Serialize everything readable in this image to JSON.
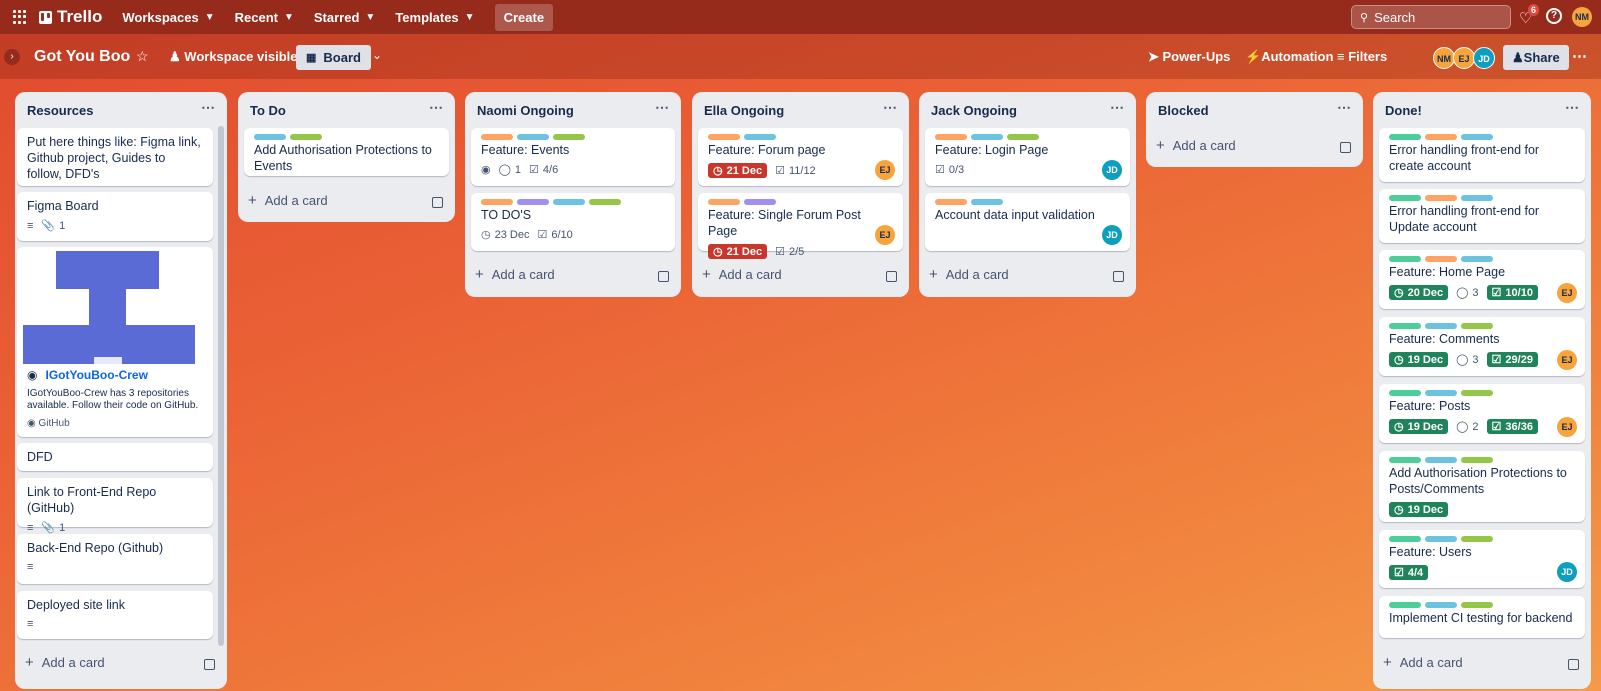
{
  "nav": {
    "brand": "Trello",
    "items": [
      "Workspaces",
      "Recent",
      "Starred",
      "Templates"
    ],
    "create": "Create",
    "search_placeholder": "Search",
    "notif_count": "6",
    "help": "?",
    "user_initials": "NM"
  },
  "board": {
    "title": "Got You Boo",
    "visibility": "Workspace visible",
    "view": "Board",
    "powerups": "Power-Ups",
    "automation": "Automation",
    "filters": "Filters",
    "members": [
      "NM",
      "EJ",
      "JD"
    ],
    "share": "Share"
  },
  "add_card_label": "Add a card",
  "colors": {
    "accent": "#962a1b",
    "label_green": "#4bce97",
    "label_orange": "#fea362",
    "label_blue": "#6cc3e0",
    "label_lime": "#94c748",
    "label_purple": "#9f8fef",
    "due_red": "#c9372c",
    "due_green": "#1f845a"
  },
  "lists": [
    {
      "title": "Resources",
      "cards": [
        {
          "title": "Put here things like: Figma link, Github project, Guides to follow, DFD's"
        },
        {
          "title": "Figma Board",
          "attachments": "1"
        },
        {
          "link_title": "IGotYouBoo-Crew",
          "link_desc": "IGotYouBoo-Crew has 3 repositories available. Follow their code on GitHub.",
          "link_source": "GitHub"
        },
        {
          "title": "DFD"
        },
        {
          "title": "Link to Front-End Repo (GitHub)",
          "attachments": "1"
        },
        {
          "title": "Back-End Repo (Github)"
        },
        {
          "title": "Deployed site link"
        }
      ]
    },
    {
      "title": "To Do",
      "cards": [
        {
          "title": "Add Authorisation Protections to Events"
        }
      ]
    },
    {
      "title": "Naomi Ongoing",
      "cards": [
        {
          "title": "Feature: Events",
          "comments": "1",
          "checklist": "4/6"
        },
        {
          "title": "TO DO'S",
          "due": "23 Dec",
          "checklist": "6/10"
        }
      ]
    },
    {
      "title": "Ella Ongoing",
      "cards": [
        {
          "title": "Feature: Forum page",
          "due": "21 Dec",
          "checklist": "11/12",
          "member": "EJ"
        },
        {
          "title": "Feature: Single Forum Post Page",
          "due": "21 Dec",
          "checklist": "2/5",
          "member": "EJ"
        }
      ]
    },
    {
      "title": "Jack Ongoing",
      "cards": [
        {
          "title": "Feature: Login Page",
          "checklist": "0/3",
          "member": "JD"
        },
        {
          "title": "Account data input validation",
          "member": "JD"
        }
      ]
    },
    {
      "title": "Blocked",
      "cards": []
    },
    {
      "title": "Done!",
      "cards": [
        {
          "title": "Error handling front-end for create account"
        },
        {
          "title": "Error handling front-end for Update account"
        },
        {
          "title": "Feature: Home Page",
          "due": "20 Dec",
          "comments": "3",
          "checklist": "10/10",
          "member": "EJ"
        },
        {
          "title": "Feature: Comments",
          "due": "19 Dec",
          "comments": "3",
          "checklist": "29/29",
          "member": "EJ"
        },
        {
          "title": "Feature: Posts",
          "due": "19 Dec",
          "comments": "2",
          "checklist": "36/36",
          "member": "EJ"
        },
        {
          "title": "Add Authorisation Protections to Posts/Comments",
          "due": "19 Dec"
        },
        {
          "title": "Feature: Users",
          "checklist": "4/4",
          "member": "JD"
        },
        {
          "title": "Implement CI testing for backend"
        }
      ]
    }
  ]
}
